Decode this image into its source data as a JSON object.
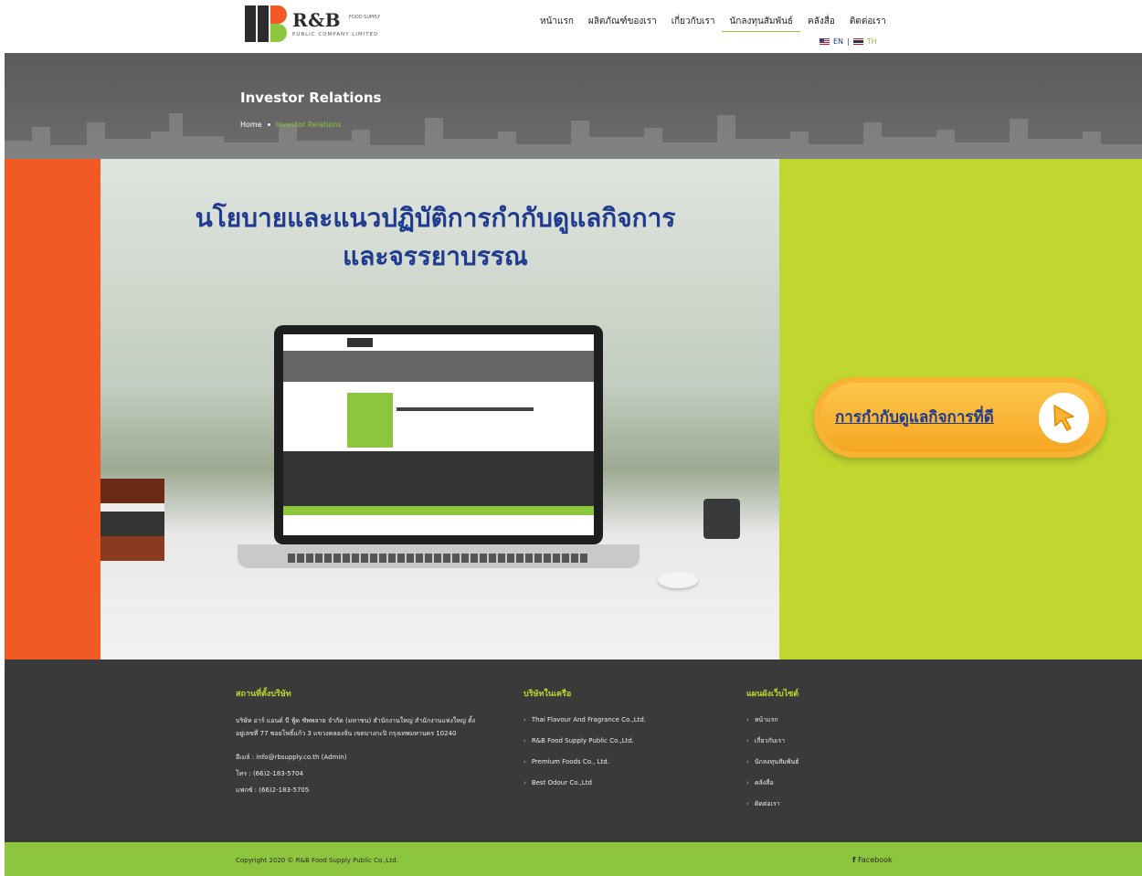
{
  "header": {
    "logo_text": "R&B",
    "logo_small": "FOOD SUPPLY",
    "logo_subtitle": "PUBLIC COMPANY LIMITED",
    "nav": [
      {
        "label": "หน้าแรก"
      },
      {
        "label": "ผลิตภัณฑ์ของเรา"
      },
      {
        "label": "เกี่ยวกับเรา"
      },
      {
        "label": "นักลงทุนสัมพันธ์",
        "active": true
      },
      {
        "label": "คลังสื่อ"
      },
      {
        "label": "ติดต่อเรา"
      }
    ],
    "lang_en": "EN",
    "lang_sep": "|",
    "lang_th": "TH"
  },
  "banner": {
    "title": "Investor Relations",
    "breadcrumb_home": "Home",
    "breadcrumb_current": "Investor Relations"
  },
  "hero": {
    "heading_line1": "นโยบายและแนวปฏิบัติการกำกับดูแลกิจการ",
    "heading_line2": "และจรรยาบรรณ",
    "cta_label": "การกำกับดูแลกิจการที่ดี"
  },
  "footer": {
    "address_title": "สถานที่ตั้งบริษัท",
    "address_text": "บริษัท อาร์ แอนด์ บี ฟู้ด ซัพพลาย จำกัด (มหาชน) สำนักงานใหญ่ สำนักงานแห่งใหญ่ ตั้งอยู่เลขที่ 77 ซอยโพธิ์แก้ว 3 แขวงคลองจั่น เขตบางกะปิ กรุงเทพมหานคร 10240",
    "email": "อีเมล์ : info@rbsupply.co.th (Admin)",
    "phone": "โทร : (66)2-183-5704",
    "fax": "แฟกซ์ : (66)2-183-5705",
    "subsidiaries_title": "บริษัทในเครือ",
    "subsidiaries": [
      "Thai Flavour And Fragrance Co.,Ltd.",
      "R&B Food Supply Public Co.,Ltd.",
      "Premium Foods Co., Ltd.",
      "Best Odour Co.,Ltd"
    ],
    "sitemap_title": "แผนผังเว็บไซต์",
    "sitemap": [
      "หน้าแรก",
      "เกี่ยวกับเรา",
      "นักลงทุนสัมพันธ์",
      "คลังสื่อ",
      "ติดต่อเรา"
    ],
    "copyright": "Copyright 2020 © R&B Food Supply Public Co.,Ltd.",
    "facebook": "Facebook"
  }
}
